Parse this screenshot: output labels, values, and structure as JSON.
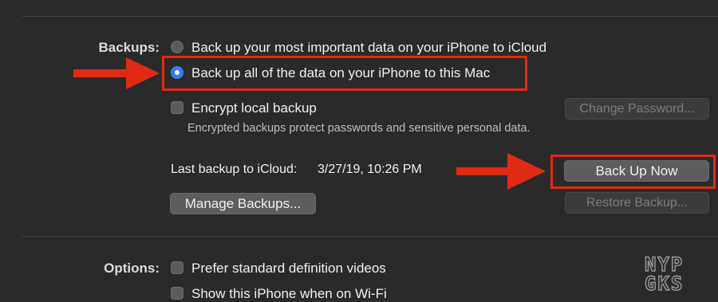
{
  "backups": {
    "section_label": "Backups:",
    "option_icloud": "Back up your most important data on your iPhone to iCloud",
    "option_mac": "Back up all of the data on your iPhone to this Mac",
    "selected_option": "mac",
    "encrypt_label": "Encrypt local backup",
    "encrypt_checked": false,
    "encrypt_helper": "Encrypted backups protect passwords and sensitive personal data.",
    "change_password_button": "Change Password...",
    "last_backup_label": "Last backup to iCloud:",
    "last_backup_value": "3/27/19, 10:26 PM",
    "back_up_now_button": "Back Up Now",
    "manage_backups_button": "Manage Backups...",
    "restore_backup_button": "Restore Backup..."
  },
  "options": {
    "section_label": "Options:",
    "prefer_sd_label": "Prefer standard definition videos",
    "prefer_sd_checked": false,
    "show_wifi_label": "Show this iPhone when on Wi-Fi",
    "show_wifi_checked": false
  },
  "watermark": {
    "line1": "NYP",
    "line2": "GKS"
  },
  "annotations": {
    "arrow_color": "#e02a14",
    "highlight_color": "#e02a14"
  }
}
